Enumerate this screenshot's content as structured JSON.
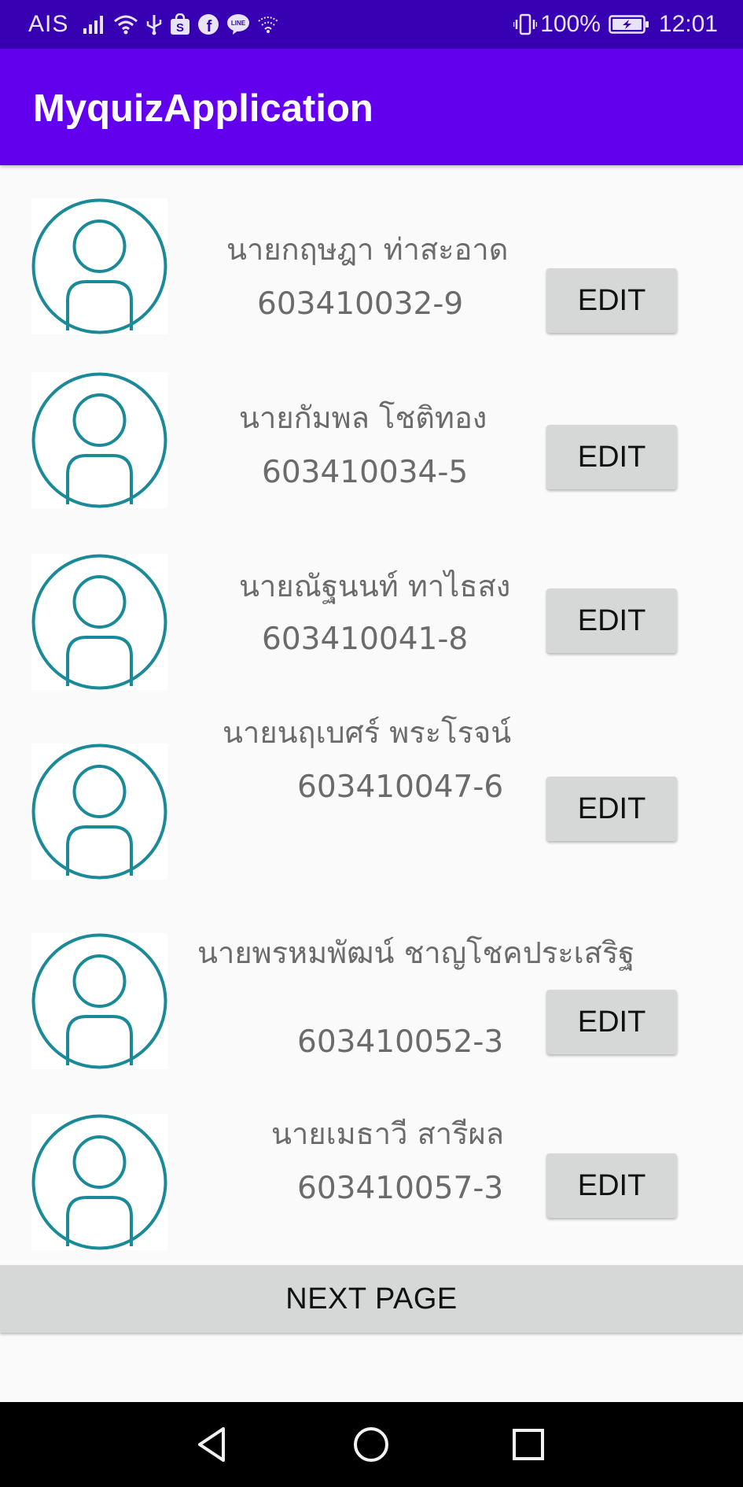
{
  "status_bar": {
    "carrier": "AIS",
    "battery_percent": "100%",
    "time": "12:01",
    "left_icons": [
      "signal-bars-icon",
      "wifi-icon",
      "usb-icon",
      "shopee-icon",
      "facebook-icon",
      "line-icon",
      "wifi-hotspot-icon"
    ],
    "right_icons": [
      "vibrate-icon",
      "battery-charging-icon"
    ]
  },
  "app_bar": {
    "title": "MyquizApplication",
    "color": "#6200ee"
  },
  "colors": {
    "status_bar": "#3700b3",
    "avatar_stroke": "#1a8a99",
    "button_bg": "#d6d7d7",
    "text_secondary": "#6b6b6b"
  },
  "students": [
    {
      "name": "นายกฤษฎา ท่าสะอาด",
      "id": "603410032-9",
      "edit_label": "EDIT"
    },
    {
      "name": "นายกัมพล โชติทอง",
      "id": "603410034-5",
      "edit_label": "EDIT"
    },
    {
      "name": "นายณัฐนนท์ ทาไธสง",
      "id": "603410041-8",
      "edit_label": "EDIT"
    },
    {
      "name": "นายนฤเบศร์ พระโรจน์",
      "id": "603410047-6",
      "edit_label": "EDIT"
    },
    {
      "name": "นายพรหมพัฒน์ ชาญโชคประเสริฐ",
      "id": "603410052-3",
      "edit_label": "EDIT"
    },
    {
      "name": "นายเมธาวี สารีผล",
      "id": "603410057-3",
      "edit_label": "EDIT"
    }
  ],
  "next_page_label": "NEXT PAGE",
  "nav_bar": {
    "buttons": [
      "back-icon",
      "home-icon",
      "recents-icon"
    ]
  }
}
